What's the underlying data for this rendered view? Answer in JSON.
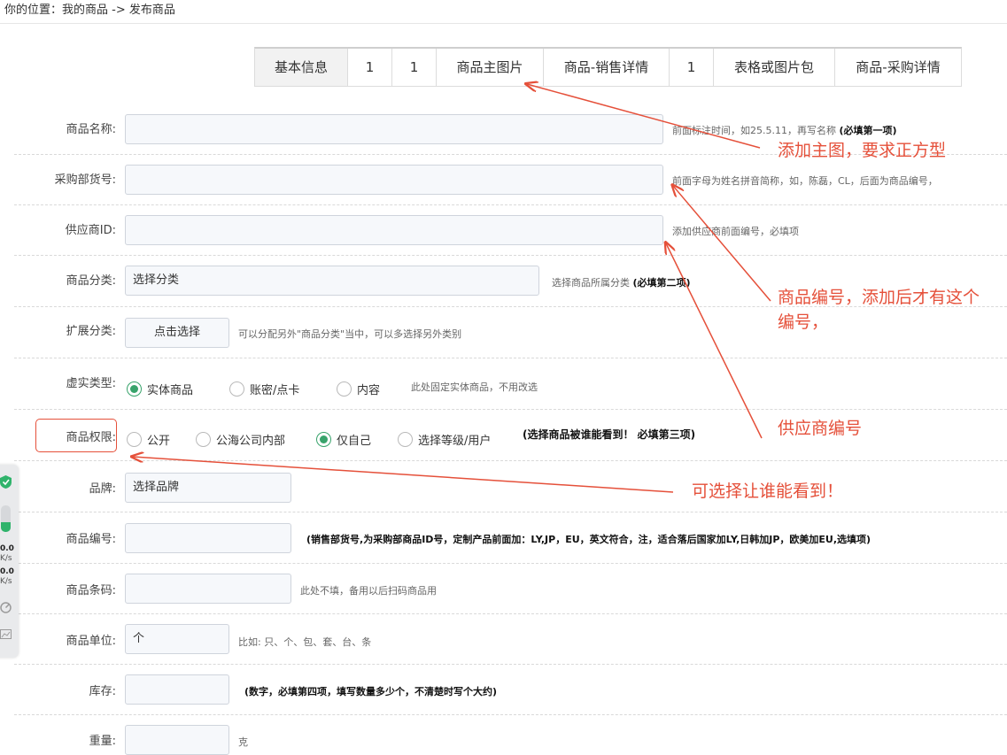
{
  "breadcrumb": "你的位置：我的商品 -> 发布商品",
  "tabs": [
    "基本信息",
    "1",
    "1",
    "商品主图片",
    "商品-销售详情",
    "1",
    "表格或图片包",
    "商品-采购详情"
  ],
  "fields": {
    "name": {
      "label": "商品名称:",
      "hint": "前面标注时间，如25.5.11，再写名称",
      "hint_bold": "(必填第一项)"
    },
    "purchase_no": {
      "label": "采购部货号:",
      "hint": "前面字母为姓名拼音简称，如，陈磊，CL，后面为商品编号，"
    },
    "supplier_id": {
      "label": "供应商ID:",
      "hint": "添加供应商前面编号，必填项"
    },
    "category": {
      "label": "商品分类:",
      "value": "选择分类",
      "hint": "选择商品所属分类",
      "hint_bold": "(必填第二项)"
    },
    "ext_category": {
      "label": "扩展分类:",
      "button": "点击选择",
      "hint": "可以分配另外\"商品分类\"当中，可以多选择另外类别"
    },
    "virtual_type": {
      "label": "虚实类型:",
      "options": [
        "实体商品",
        "账密/点卡",
        "内容"
      ],
      "selected": "实体商品",
      "hint": "此处固定实体商品，不用改选"
    },
    "permission": {
      "label": "商品权限:",
      "options": [
        "公开",
        "公海公司内部",
        "仅自己",
        "选择等级/用户"
      ],
      "selected": "仅自己",
      "hint": "(选择商品被谁能看到！ 必填第三项)"
    },
    "brand": {
      "label": "品牌:",
      "value": "选择品牌"
    },
    "product_no": {
      "label": "商品编号:",
      "hint": "(销售部货号,为采购部商品ID号，定制产品前面加：LY,JP，EU，英文符合，注，适合落后国家加LY,日韩加JP，欧美加EU,选填项)"
    },
    "barcode": {
      "label": "商品条码:",
      "hint": "此处不填，备用以后扫码商品用"
    },
    "unit": {
      "label": "商品单位:",
      "value": "个",
      "hint": "比如: 只、个、包、套、台、条"
    },
    "stock": {
      "label": "库存:",
      "hint": "(数字，必填第四项，填写数量多少个，不清楚时写个大约)"
    },
    "weight": {
      "label": "重量:",
      "hint": "克"
    }
  },
  "annotations": {
    "main_image": "添加主图，要求正方型",
    "product_no_line1": "商品编号，添加后才有这个",
    "product_no_line2": "编号，",
    "supplier": "供应商编号",
    "visibility": "可选择让谁能看到！"
  },
  "side_panel": {
    "speed1": "0.0",
    "unit1": "K/s",
    "speed2": "0.0",
    "unit2": "K/s"
  },
  "colors": {
    "annotation": "#e5503a",
    "radio_checked": "#38a36b",
    "input_bg": "#f6f8fb"
  }
}
